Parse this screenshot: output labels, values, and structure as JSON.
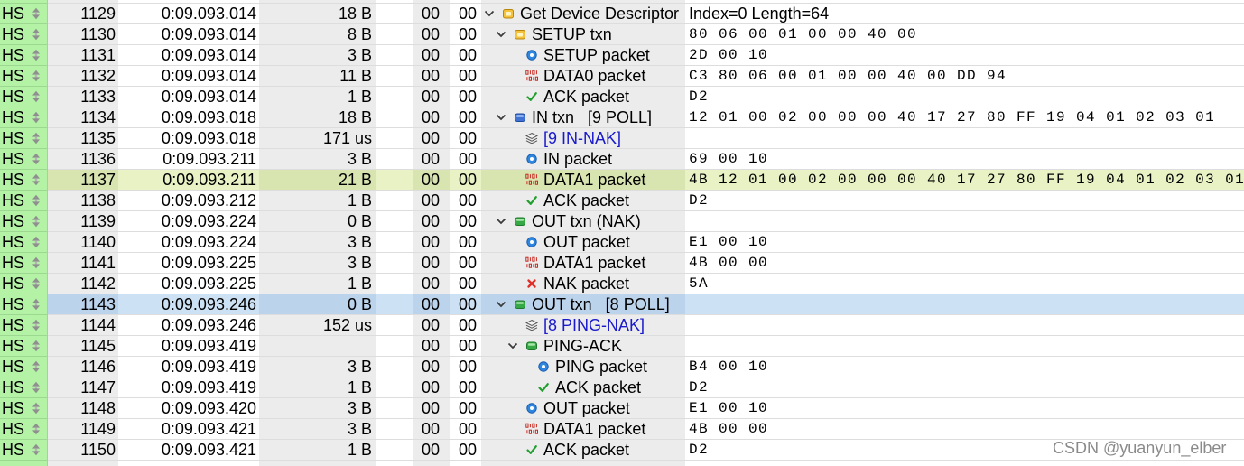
{
  "colors": {
    "speed_bg": "#b4f2a6",
    "column_base": "#ffffff",
    "column_alt": "#ececec",
    "match_base": "#e9f2c5",
    "match_alt": "#d9e5b1",
    "selected_base": "#cde1f5",
    "selected_alt": "#bcd3ec",
    "link": "#1a1acc",
    "watermark": "#8a8a8a"
  },
  "capture": {
    "rows": [
      {
        "speed": "HS",
        "index": "1129",
        "time": "0:09.093.014",
        "length": "18 B",
        "dev": "00",
        "ep": "00",
        "depth": 0,
        "toggle": "expanded",
        "icon": "transfer-icon",
        "label": "Get Device Descriptor",
        "data": "Index=0 Length=64",
        "data_format": "text"
      },
      {
        "speed": "HS",
        "index": "1130",
        "time": "0:09.093.014",
        "length": "8 B",
        "dev": "00",
        "ep": "00",
        "depth": 1,
        "toggle": "expanded",
        "icon": "transfer-icon",
        "label": "SETUP txn",
        "data": "80 06 00 01 00 00 40 00",
        "data_format": "hex"
      },
      {
        "speed": "HS",
        "index": "1131",
        "time": "0:09.093.014",
        "length": "3 B",
        "dev": "00",
        "ep": "00",
        "depth": 2,
        "toggle": "none",
        "icon": "token-icon",
        "label": "SETUP packet",
        "data": "2D 00 10",
        "data_format": "hex"
      },
      {
        "speed": "HS",
        "index": "1132",
        "time": "0:09.093.014",
        "length": "11 B",
        "dev": "00",
        "ep": "00",
        "depth": 2,
        "toggle": "none",
        "icon": "data-icon",
        "label": "DATA0 packet",
        "data": "C3 80 06 00 01 00 00 40 00 DD 94",
        "data_format": "hex"
      },
      {
        "speed": "HS",
        "index": "1133",
        "time": "0:09.093.014",
        "length": "1 B",
        "dev": "00",
        "ep": "00",
        "depth": 2,
        "toggle": "none",
        "icon": "check-icon",
        "label": "ACK packet",
        "data": "D2",
        "data_format": "hex"
      },
      {
        "speed": "HS",
        "index": "1134",
        "time": "0:09.093.018",
        "length": "18 B",
        "dev": "00",
        "ep": "00",
        "depth": 1,
        "toggle": "expanded",
        "icon": "in-txn-icon",
        "label": "IN txn   [9 POLL]",
        "data": "12 01 00 02 00 00 00 40 17 27 80 FF 19 04 01 02 03 01",
        "data_format": "hex"
      },
      {
        "speed": "HS",
        "index": "1135",
        "time": "0:09.093.018",
        "length": "171 us",
        "dev": "00",
        "ep": "00",
        "depth": 2,
        "toggle": "none",
        "icon": "layers-icon",
        "label": "[9 IN-NAK]",
        "label_style": "link"
      },
      {
        "speed": "HS",
        "index": "1136",
        "time": "0:09.093.211",
        "length": "3 B",
        "dev": "00",
        "ep": "00",
        "depth": 2,
        "toggle": "none",
        "icon": "token-icon",
        "label": "IN packet",
        "data": "69 00 10",
        "data_format": "hex"
      },
      {
        "speed": "HS",
        "index": "1137",
        "time": "0:09.093.211",
        "length": "21 B",
        "dev": "00",
        "ep": "00",
        "depth": 2,
        "toggle": "none",
        "icon": "data-icon",
        "label": "DATA1 packet",
        "data": "4B 12 01 00 02 00 00 00 40 17 27 80 FF 19 04 01 02 03 01",
        "data_format": "hex",
        "highlight": "match"
      },
      {
        "speed": "HS",
        "index": "1138",
        "time": "0:09.093.212",
        "length": "1 B",
        "dev": "00",
        "ep": "00",
        "depth": 2,
        "toggle": "none",
        "icon": "check-icon",
        "label": "ACK packet",
        "data": "D2",
        "data_format": "hex"
      },
      {
        "speed": "HS",
        "index": "1139",
        "time": "0:09.093.224",
        "length": "0 B",
        "dev": "00",
        "ep": "00",
        "depth": 1,
        "toggle": "expanded",
        "icon": "out-txn-icon",
        "label": "OUT txn (NAK)"
      },
      {
        "speed": "HS",
        "index": "1140",
        "time": "0:09.093.224",
        "length": "3 B",
        "dev": "00",
        "ep": "00",
        "depth": 2,
        "toggle": "none",
        "icon": "token-icon",
        "label": "OUT packet",
        "data": "E1 00 10",
        "data_format": "hex"
      },
      {
        "speed": "HS",
        "index": "1141",
        "time": "0:09.093.225",
        "length": "3 B",
        "dev": "00",
        "ep": "00",
        "depth": 2,
        "toggle": "none",
        "icon": "data-icon",
        "label": "DATA1 packet",
        "data": "4B 00 00",
        "data_format": "hex"
      },
      {
        "speed": "HS",
        "index": "1142",
        "time": "0:09.093.225",
        "length": "1 B",
        "dev": "00",
        "ep": "00",
        "depth": 2,
        "toggle": "none",
        "icon": "cross-icon",
        "label": "NAK packet",
        "data": "5A",
        "data_format": "hex"
      },
      {
        "speed": "HS",
        "index": "1143",
        "time": "0:09.093.246",
        "length": "0 B",
        "dev": "00",
        "ep": "00",
        "depth": 1,
        "toggle": "expanded",
        "icon": "out-txn-icon",
        "label": "OUT txn   [8 POLL]",
        "highlight": "selected"
      },
      {
        "speed": "HS",
        "index": "1144",
        "time": "0:09.093.246",
        "length": "152 us",
        "dev": "00",
        "ep": "00",
        "depth": 2,
        "toggle": "none",
        "icon": "layers-icon",
        "label": "[8 PING-NAK]",
        "label_style": "link"
      },
      {
        "speed": "HS",
        "index": "1145",
        "time": "0:09.093.419",
        "dev": "00",
        "ep": "00",
        "depth": 2,
        "toggle": "expanded",
        "icon": "out-txn-icon",
        "label": "PING-ACK"
      },
      {
        "speed": "HS",
        "index": "1146",
        "time": "0:09.093.419",
        "length": "3 B",
        "dev": "00",
        "ep": "00",
        "depth": 3,
        "toggle": "none",
        "icon": "token-icon",
        "label": "PING packet",
        "data": "B4 00 10",
        "data_format": "hex"
      },
      {
        "speed": "HS",
        "index": "1147",
        "time": "0:09.093.419",
        "length": "1 B",
        "dev": "00",
        "ep": "00",
        "depth": 3,
        "toggle": "none",
        "icon": "check-icon",
        "label": "ACK packet",
        "data": "D2",
        "data_format": "hex"
      },
      {
        "speed": "HS",
        "index": "1148",
        "time": "0:09.093.420",
        "length": "3 B",
        "dev": "00",
        "ep": "00",
        "depth": 2,
        "toggle": "none",
        "icon": "token-icon",
        "label": "OUT packet",
        "data": "E1 00 10",
        "data_format": "hex"
      },
      {
        "speed": "HS",
        "index": "1149",
        "time": "0:09.093.421",
        "length": "3 B",
        "dev": "00",
        "ep": "00",
        "depth": 2,
        "toggle": "none",
        "icon": "data-icon",
        "label": "DATA1 packet",
        "data": "4B 00 00",
        "data_format": "hex"
      },
      {
        "speed": "HS",
        "index": "1150",
        "time": "0:09.093.421",
        "length": "1 B",
        "dev": "00",
        "ep": "00",
        "depth": 2,
        "toggle": "none",
        "icon": "check-icon",
        "label": "ACK packet",
        "data": "D2",
        "data_format": "hex"
      }
    ]
  },
  "watermark": "CSDN @yuanyun_elber"
}
